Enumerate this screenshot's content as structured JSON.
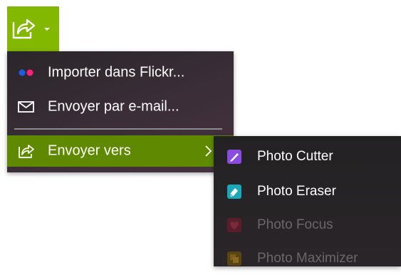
{
  "share_button": {
    "icon": "share-icon",
    "caret": "caret-down-icon",
    "color": "#82b800"
  },
  "menu": {
    "items": [
      {
        "label": "Importer dans Flickr...",
        "icon": "flickr-icon"
      },
      {
        "label": "Envoyer par e-mail...",
        "icon": "envelope-icon"
      },
      {
        "label": "Envoyer vers",
        "icon": "share-icon",
        "highlighted": true,
        "submenu_icon": "chevron-right-icon"
      }
    ],
    "highlight_color": "#5f8a00"
  },
  "submenu": {
    "items": [
      {
        "label": "Photo Cutter",
        "icon": "photo-cutter-icon",
        "enabled": true
      },
      {
        "label": "Photo Eraser",
        "icon": "photo-eraser-icon",
        "enabled": true
      },
      {
        "label": "Photo Focus",
        "icon": "photo-focus-icon",
        "enabled": false
      },
      {
        "label": "Photo Maximizer",
        "icon": "photo-maximizer-icon",
        "enabled": false
      }
    ]
  }
}
